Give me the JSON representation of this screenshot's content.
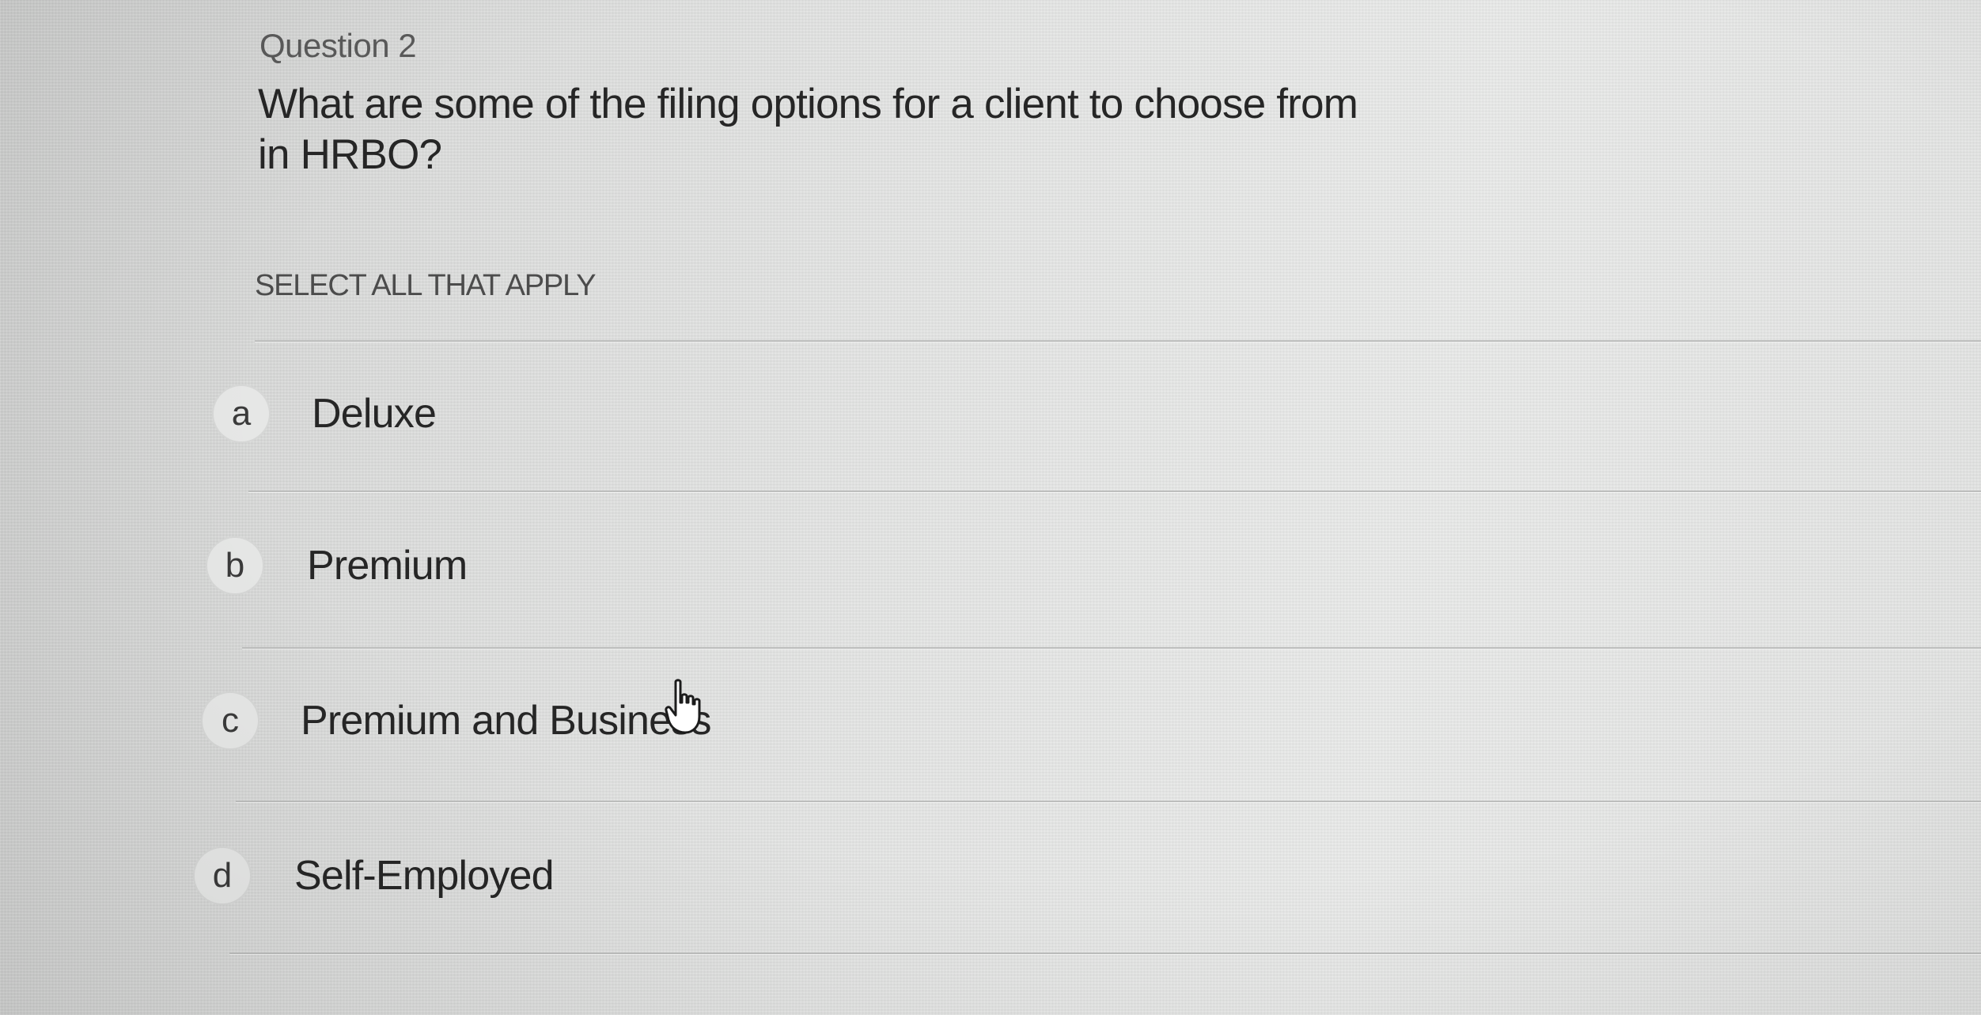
{
  "question": {
    "label": "Question 2",
    "text": "What are some of the filing options for a client to choose from in HRBO?",
    "instruction": "SELECT ALL THAT APPLY"
  },
  "options": [
    {
      "letter": "a",
      "label": "Deluxe"
    },
    {
      "letter": "b",
      "label": "Premium"
    },
    {
      "letter": "c",
      "label": "Premium and Business"
    },
    {
      "letter": "d",
      "label": "Self-Employed"
    }
  ],
  "cursor": {
    "icon": "hand-pointer-icon"
  }
}
